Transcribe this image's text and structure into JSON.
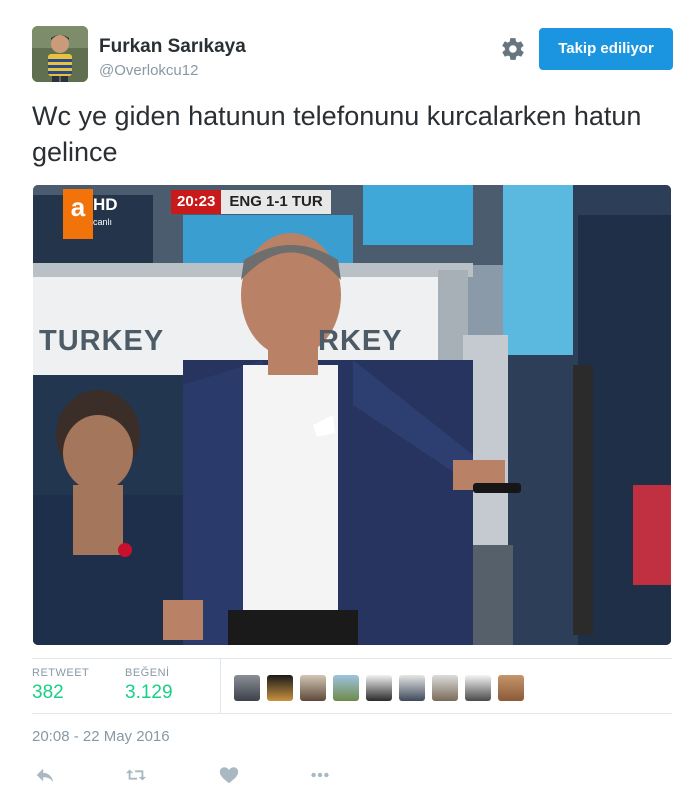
{
  "user": {
    "full_name": "Furkan Sarıkaya",
    "screen_name": "@Overlokcu12",
    "avatar_icon": "user-avatar"
  },
  "follow_button": {
    "label": "Takip ediliyor"
  },
  "settings_icon": "gear-icon",
  "tweet": {
    "text": "Wc ye giden hatunun telefonunu kurcalarken hatun gelince"
  },
  "media": {
    "channel_logo": "a",
    "channel_hd": "HD",
    "channel_live": "canlı",
    "score_time": "20:23",
    "score_teams": "ENG 1-1 TUR",
    "banner_left": "TURKEY",
    "banner_right": "RKEY"
  },
  "stats": {
    "retweet_label": "RETWEET",
    "retweet_count": "382",
    "like_label": "BEĞENİ",
    "like_count": "3.129"
  },
  "timestamp": "20:08 - 22 May 2016",
  "colors": {
    "accent": "#1b95e0",
    "count_green": "#19cf86",
    "muted": "#8899a6"
  },
  "actions": [
    "reply-icon",
    "retweet-icon",
    "like-icon",
    "more-icon"
  ]
}
